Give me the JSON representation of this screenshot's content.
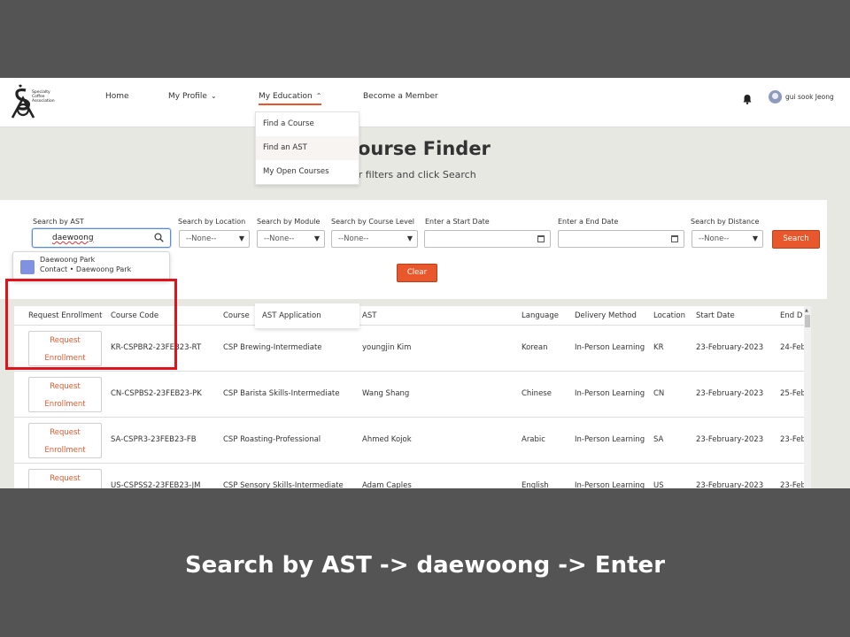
{
  "nav": {
    "logo_line1": "Specialty",
    "logo_line2": "Coffee",
    "logo_line3": "Association",
    "home": "Home",
    "my_profile": "My Profile",
    "my_education": "My Education",
    "become_member": "Become a Member",
    "user_name": "gui sook Jeong"
  },
  "edu_menu": {
    "items": [
      "Find a Course",
      "Find an AST",
      "My Open Courses"
    ],
    "ast_application": "AST Application"
  },
  "hero": {
    "title": "ourse Finder",
    "subtitle": "er filters and click Search"
  },
  "filters": {
    "ast_label": "Search by AST",
    "ast_value": "daewoong",
    "location_label": "Search by Location",
    "location_value": "--None--",
    "module_label": "Search by Module",
    "module_value": "--None--",
    "level_label": "Search by Course Level",
    "level_value": "--None--",
    "start_label": "Enter a Start Date",
    "end_label": "Enter a End Date",
    "distance_label": "Search by Distance",
    "distance_value": "--None--",
    "search_button": "Search",
    "clear_button": "Clear"
  },
  "suggestion": {
    "name": "Daewoong Park",
    "meta": "Contact • Daewoong Park"
  },
  "table": {
    "headers": [
      "Request Enrollment",
      "Course Code",
      "Course",
      "AST",
      "Language",
      "Delivery Method",
      "Location",
      "Start Date",
      "End D"
    ],
    "request_line1": "Request",
    "request_line2": "Enrollment",
    "rows": [
      {
        "code": "KR-CSPBR2-23FEB23-RT",
        "course": "CSP Brewing-Intermediate",
        "ast": "youngjin Kim",
        "language": "Korean",
        "delivery": "In-Person Learning",
        "location": "KR",
        "start": "23-February-2023",
        "end": "24-Feb"
      },
      {
        "code": "CN-CSPBS2-23FEB23-PK",
        "course": "CSP Barista Skills-Intermediate",
        "ast": "Wang Shang",
        "language": "Chinese",
        "delivery": "In-Person Learning",
        "location": "CN",
        "start": "23-February-2023",
        "end": "25-Feb"
      },
      {
        "code": "SA-CSPR3-23FEB23-FB",
        "course": "CSP Roasting-Professional",
        "ast": "Ahmed Kojok",
        "language": "Arabic",
        "delivery": "In-Person Learning",
        "location": "SA",
        "start": "23-February-2023",
        "end": "23-Feb"
      },
      {
        "code": "US-CSPSS2-23FEB23-JM",
        "course": "CSP Sensory Skills-Intermediate",
        "ast": "Adam Caples",
        "language": "English",
        "delivery": "In-Person Learning",
        "location": "US",
        "start": "23-February-2023",
        "end": "23-Feb"
      }
    ]
  },
  "caption": "Search by AST -> daewoong -> Enter",
  "colors": {
    "accent": "#e9582c",
    "highlight_box": "#e0121b"
  }
}
